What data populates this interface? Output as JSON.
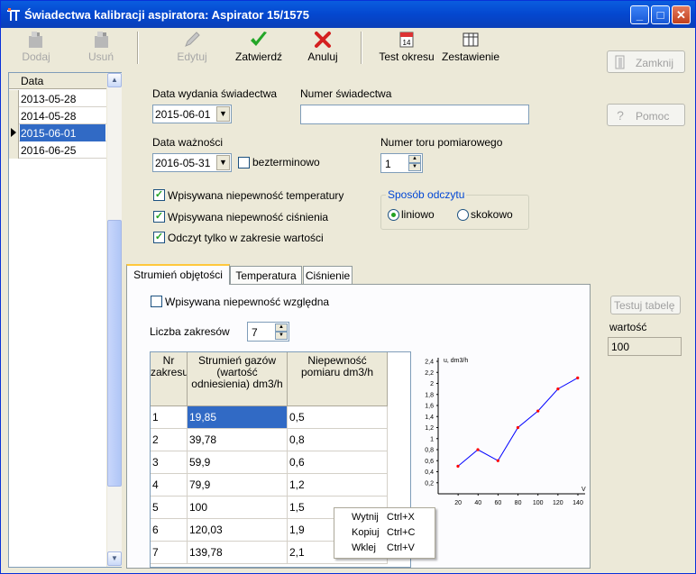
{
  "window": {
    "title": "Świadectwa kalibracji aspiratora: Aspirator  15/1575",
    "caption_buttons": [
      "_",
      "□",
      "✕"
    ]
  },
  "toolbar": {
    "add": "Dodaj",
    "delete": "Usuń",
    "edit": "Edytuj",
    "approve": "Zatwierdź",
    "cancel": "Anuluj",
    "test": "Test okresu",
    "summary": "Zestawienie",
    "calendar_day": "14"
  },
  "left_list": {
    "header": "Data",
    "rows": [
      "2013-05-28",
      "2014-05-28",
      "2015-06-01",
      "2016-06-25"
    ],
    "selected_index": 2
  },
  "form": {
    "issue_date_label": "Data wydania świadectwa",
    "issue_date": "2015-06-01",
    "cert_no_label": "Numer świadectwa",
    "cert_no": "",
    "valid_label": "Data ważności",
    "valid_date": "2016-05-31",
    "indefinite_label": "bezterminowo",
    "track_label": "Numer toru pomiarowego",
    "track_value": "1",
    "chk_temp": "Wpisywana niepewność temperatury",
    "chk_pressure": "Wpisywana niepewność ciśnienia",
    "chk_range": "Odczyt tylko w zakresie wartości",
    "read_mode_title": "Sposób odczytu",
    "read_linear": "liniowo",
    "read_step": "skokowo"
  },
  "right_buttons": {
    "close": "Zamknij",
    "help": "Pomoc",
    "test_table": "Testuj tabelę",
    "value_label": "wartość",
    "value": "100"
  },
  "tabs": [
    "Strumień objętości",
    "Temperatura",
    "Ciśnienie"
  ],
  "tab_content": {
    "relative_chk": "Wpisywana niepewność względna",
    "ranges_label": "Liczba zakresów",
    "ranges_value": "7",
    "table": {
      "headers": [
        "Nr zakresu",
        "Strumień gazów (wartość odniesienia) dm3/h",
        "Niepewność pomiaru dm3/h"
      ],
      "rows": [
        [
          "1",
          "19,85",
          "0,5"
        ],
        [
          "2",
          "39,78",
          "0,8"
        ],
        [
          "3",
          "59,9",
          "0,6"
        ],
        [
          "4",
          "79,9",
          "1,2"
        ],
        [
          "5",
          "100",
          "1,5"
        ],
        [
          "6",
          "120,03",
          "1,9"
        ],
        [
          "7",
          "139,78",
          "2,1"
        ]
      ]
    }
  },
  "context_menu": [
    {
      "label": "Wytnij",
      "shortcut": "Ctrl+X"
    },
    {
      "label": "Kopiuj",
      "shortcut": "Ctrl+C"
    },
    {
      "label": "Wklej",
      "shortcut": "Ctrl+V"
    }
  ],
  "chart_data": {
    "type": "line",
    "x": [
      19.85,
      39.78,
      59.9,
      79.9,
      100,
      120.03,
      139.78
    ],
    "values": [
      0.5,
      0.8,
      0.6,
      1.2,
      1.5,
      1.9,
      2.1
    ],
    "ylabel": "u,  dm3/h",
    "xlabel": "V",
    "yticks": [
      "0,2",
      "0,4",
      "0,6",
      "0,8",
      "1",
      "1,2",
      "1,4",
      "1,6",
      "1,8",
      "2",
      "2,2",
      "2,4"
    ],
    "xticks": [
      "20",
      "40",
      "60",
      "80",
      "100",
      "120",
      "140"
    ],
    "xlim": [
      0,
      140
    ],
    "ylim": [
      0,
      2.4
    ],
    "line_color": "#0000ff",
    "marker_color": "#ff0000"
  }
}
